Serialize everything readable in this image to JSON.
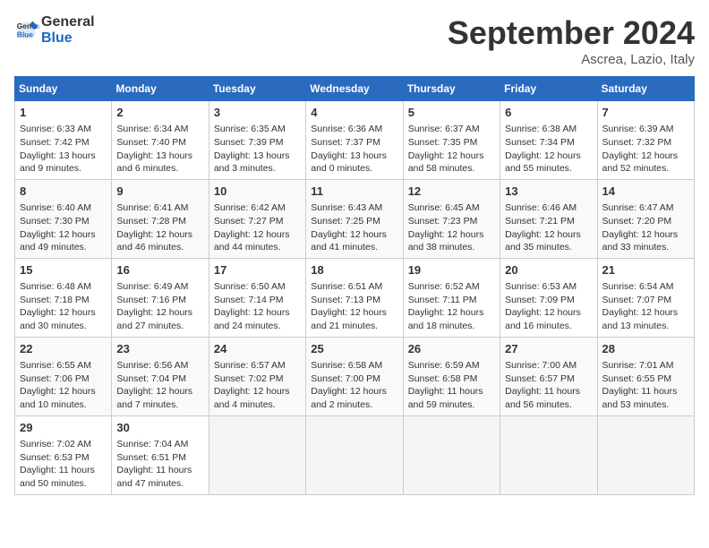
{
  "header": {
    "logo_line1": "General",
    "logo_line2": "Blue",
    "month_title": "September 2024",
    "location": "Ascrea, Lazio, Italy"
  },
  "weekdays": [
    "Sunday",
    "Monday",
    "Tuesday",
    "Wednesday",
    "Thursday",
    "Friday",
    "Saturday"
  ],
  "weeks": [
    [
      {
        "day": "1",
        "sunrise": "Sunrise: 6:33 AM",
        "sunset": "Sunset: 7:42 PM",
        "daylight": "Daylight: 13 hours and 9 minutes."
      },
      {
        "day": "2",
        "sunrise": "Sunrise: 6:34 AM",
        "sunset": "Sunset: 7:40 PM",
        "daylight": "Daylight: 13 hours and 6 minutes."
      },
      {
        "day": "3",
        "sunrise": "Sunrise: 6:35 AM",
        "sunset": "Sunset: 7:39 PM",
        "daylight": "Daylight: 13 hours and 3 minutes."
      },
      {
        "day": "4",
        "sunrise": "Sunrise: 6:36 AM",
        "sunset": "Sunset: 7:37 PM",
        "daylight": "Daylight: 13 hours and 0 minutes."
      },
      {
        "day": "5",
        "sunrise": "Sunrise: 6:37 AM",
        "sunset": "Sunset: 7:35 PM",
        "daylight": "Daylight: 12 hours and 58 minutes."
      },
      {
        "day": "6",
        "sunrise": "Sunrise: 6:38 AM",
        "sunset": "Sunset: 7:34 PM",
        "daylight": "Daylight: 12 hours and 55 minutes."
      },
      {
        "day": "7",
        "sunrise": "Sunrise: 6:39 AM",
        "sunset": "Sunset: 7:32 PM",
        "daylight": "Daylight: 12 hours and 52 minutes."
      }
    ],
    [
      {
        "day": "8",
        "sunrise": "Sunrise: 6:40 AM",
        "sunset": "Sunset: 7:30 PM",
        "daylight": "Daylight: 12 hours and 49 minutes."
      },
      {
        "day": "9",
        "sunrise": "Sunrise: 6:41 AM",
        "sunset": "Sunset: 7:28 PM",
        "daylight": "Daylight: 12 hours and 46 minutes."
      },
      {
        "day": "10",
        "sunrise": "Sunrise: 6:42 AM",
        "sunset": "Sunset: 7:27 PM",
        "daylight": "Daylight: 12 hours and 44 minutes."
      },
      {
        "day": "11",
        "sunrise": "Sunrise: 6:43 AM",
        "sunset": "Sunset: 7:25 PM",
        "daylight": "Daylight: 12 hours and 41 minutes."
      },
      {
        "day": "12",
        "sunrise": "Sunrise: 6:45 AM",
        "sunset": "Sunset: 7:23 PM",
        "daylight": "Daylight: 12 hours and 38 minutes."
      },
      {
        "day": "13",
        "sunrise": "Sunrise: 6:46 AM",
        "sunset": "Sunset: 7:21 PM",
        "daylight": "Daylight: 12 hours and 35 minutes."
      },
      {
        "day": "14",
        "sunrise": "Sunrise: 6:47 AM",
        "sunset": "Sunset: 7:20 PM",
        "daylight": "Daylight: 12 hours and 33 minutes."
      }
    ],
    [
      {
        "day": "15",
        "sunrise": "Sunrise: 6:48 AM",
        "sunset": "Sunset: 7:18 PM",
        "daylight": "Daylight: 12 hours and 30 minutes."
      },
      {
        "day": "16",
        "sunrise": "Sunrise: 6:49 AM",
        "sunset": "Sunset: 7:16 PM",
        "daylight": "Daylight: 12 hours and 27 minutes."
      },
      {
        "day": "17",
        "sunrise": "Sunrise: 6:50 AM",
        "sunset": "Sunset: 7:14 PM",
        "daylight": "Daylight: 12 hours and 24 minutes."
      },
      {
        "day": "18",
        "sunrise": "Sunrise: 6:51 AM",
        "sunset": "Sunset: 7:13 PM",
        "daylight": "Daylight: 12 hours and 21 minutes."
      },
      {
        "day": "19",
        "sunrise": "Sunrise: 6:52 AM",
        "sunset": "Sunset: 7:11 PM",
        "daylight": "Daylight: 12 hours and 18 minutes."
      },
      {
        "day": "20",
        "sunrise": "Sunrise: 6:53 AM",
        "sunset": "Sunset: 7:09 PM",
        "daylight": "Daylight: 12 hours and 16 minutes."
      },
      {
        "day": "21",
        "sunrise": "Sunrise: 6:54 AM",
        "sunset": "Sunset: 7:07 PM",
        "daylight": "Daylight: 12 hours and 13 minutes."
      }
    ],
    [
      {
        "day": "22",
        "sunrise": "Sunrise: 6:55 AM",
        "sunset": "Sunset: 7:06 PM",
        "daylight": "Daylight: 12 hours and 10 minutes."
      },
      {
        "day": "23",
        "sunrise": "Sunrise: 6:56 AM",
        "sunset": "Sunset: 7:04 PM",
        "daylight": "Daylight: 12 hours and 7 minutes."
      },
      {
        "day": "24",
        "sunrise": "Sunrise: 6:57 AM",
        "sunset": "Sunset: 7:02 PM",
        "daylight": "Daylight: 12 hours and 4 minutes."
      },
      {
        "day": "25",
        "sunrise": "Sunrise: 6:58 AM",
        "sunset": "Sunset: 7:00 PM",
        "daylight": "Daylight: 12 hours and 2 minutes."
      },
      {
        "day": "26",
        "sunrise": "Sunrise: 6:59 AM",
        "sunset": "Sunset: 6:58 PM",
        "daylight": "Daylight: 11 hours and 59 minutes."
      },
      {
        "day": "27",
        "sunrise": "Sunrise: 7:00 AM",
        "sunset": "Sunset: 6:57 PM",
        "daylight": "Daylight: 11 hours and 56 minutes."
      },
      {
        "day": "28",
        "sunrise": "Sunrise: 7:01 AM",
        "sunset": "Sunset: 6:55 PM",
        "daylight": "Daylight: 11 hours and 53 minutes."
      }
    ],
    [
      {
        "day": "29",
        "sunrise": "Sunrise: 7:02 AM",
        "sunset": "Sunset: 6:53 PM",
        "daylight": "Daylight: 11 hours and 50 minutes."
      },
      {
        "day": "30",
        "sunrise": "Sunrise: 7:04 AM",
        "sunset": "Sunset: 6:51 PM",
        "daylight": "Daylight: 11 hours and 47 minutes."
      },
      null,
      null,
      null,
      null,
      null
    ]
  ]
}
